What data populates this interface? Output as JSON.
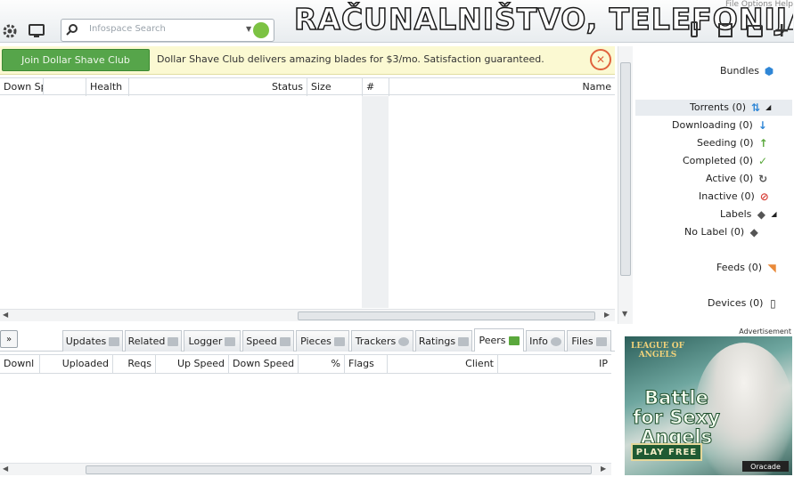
{
  "toolbar": {
    "search_placeholder": "Infospace Search",
    "menu_hint": "File   Options   Help",
    "watermark": "RAČUNALNIŠTVO, TELEFONIJA"
  },
  "ad_bar": {
    "message": "Dollar Shave Club delivers amazing blades for $3/mo. Satisfaction guaranteed.",
    "button_label": "Join Dollar Shave Club"
  },
  "torrent_list": {
    "columns": [
      "Name",
      "#",
      "Size",
      "Status",
      "Health",
      "Down Speed"
    ]
  },
  "sidebar": {
    "bundles": "Bundles",
    "torrents": "Torrents (0)",
    "downloading": "Downloading (0)",
    "seeding": "Seeding (0)",
    "completed": "Completed (0)",
    "active": "Active (0)",
    "inactive": "Inactive (0)",
    "labels": "Labels",
    "no_label": "No Label (0)",
    "feeds": "Feeds (0)",
    "devices": "Devices (0)"
  },
  "tabs": [
    "Files",
    "Info",
    "Peers",
    "Ratings",
    "Trackers",
    "Pieces",
    "Speed",
    "Logger",
    "Related",
    "Updates"
  ],
  "peers_list": {
    "columns": [
      "IP",
      "Client",
      "Flags",
      "%",
      "Down Speed",
      "Up Speed",
      "Reqs",
      "Uploaded",
      "Downl"
    ]
  },
  "advertisement": {
    "label": "Advertisement",
    "logo": "LEAGUE OF ANGELS",
    "headline": "Battle for Sexy Angels",
    "cta": "PLAY FREE",
    "brand": "Oracade"
  },
  "colors": {
    "ad_bar_bg": "#fbf9d2",
    "join_button": "#56a54a",
    "accent_blue": "#2f86d6",
    "accent_green": "#5aa83c"
  }
}
